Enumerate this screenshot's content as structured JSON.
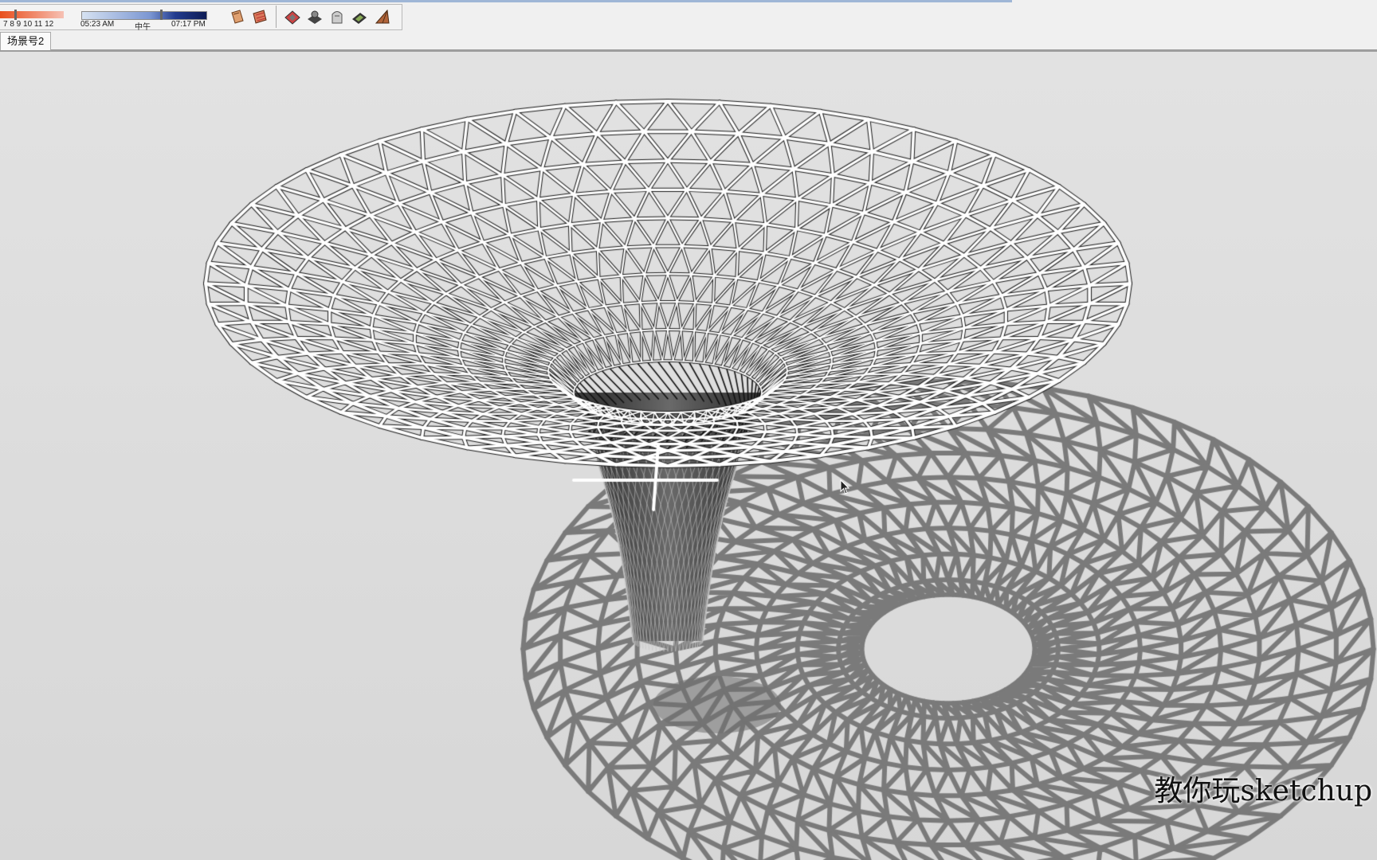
{
  "shadow_settings": {
    "month_labels": "7  8  9  10 11 12",
    "time_start": "05:23 AM",
    "time_noon": "中午",
    "time_end": "07:17 PM"
  },
  "toolbar": {
    "tools": [
      "section-plane-icon",
      "display-section-plane-icon",
      "sandbox-from-contours-icon",
      "sandbox-from-scratch-icon",
      "smoove-icon",
      "stamp-icon",
      "drape-icon",
      "add-detail-icon",
      "flip-edge-icon"
    ]
  },
  "scene_tabs": {
    "active": "场景号2"
  },
  "viewport": {
    "watermark": "教你玩sketchup"
  },
  "colors": {
    "toolbar_bg": "#f0f0f0",
    "viewport_bg": "#dcdcdc",
    "shadow": "#7a7a7a",
    "wire": "#1a1a1a"
  }
}
